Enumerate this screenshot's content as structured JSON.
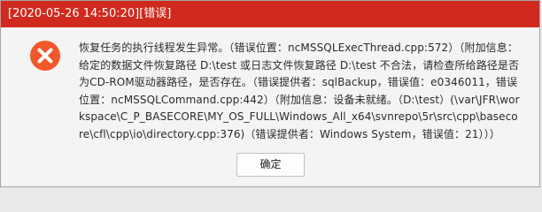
{
  "dialog": {
    "title": "[2020-05-26 14:50:20][错误]",
    "icon": "error-x-icon",
    "message": "恢复任务的执行线程发生异常。（错误位置：ncMSSQLExecThread.cpp:572）（附加信息：给定的数据文件恢复路径 D:\\test 或日志文件恢复路径 D:\\test 不合法，请检查所给路径是否为CD-ROM驱动器路径，是否存在。（错误提供者：sqlBackup，错误值：e0346011，错误位置：ncMSSQLCommand.cpp:442）（附加信息：设备未就绪。（D:\\test）(\\var\\JFR\\workspace\\C_P_BASECORE\\MY_OS_FULL\\Windows_All_x64\\svnrepo\\5r\\src\\cpp\\basecore\\cfl\\cpp\\io\\directory.cpp:376)（错误提供者：Windows System，错误值：21）））",
    "ok_label": "确定"
  },
  "colors": {
    "titlebar": "#d02a1e",
    "icon": "#f1592a"
  }
}
